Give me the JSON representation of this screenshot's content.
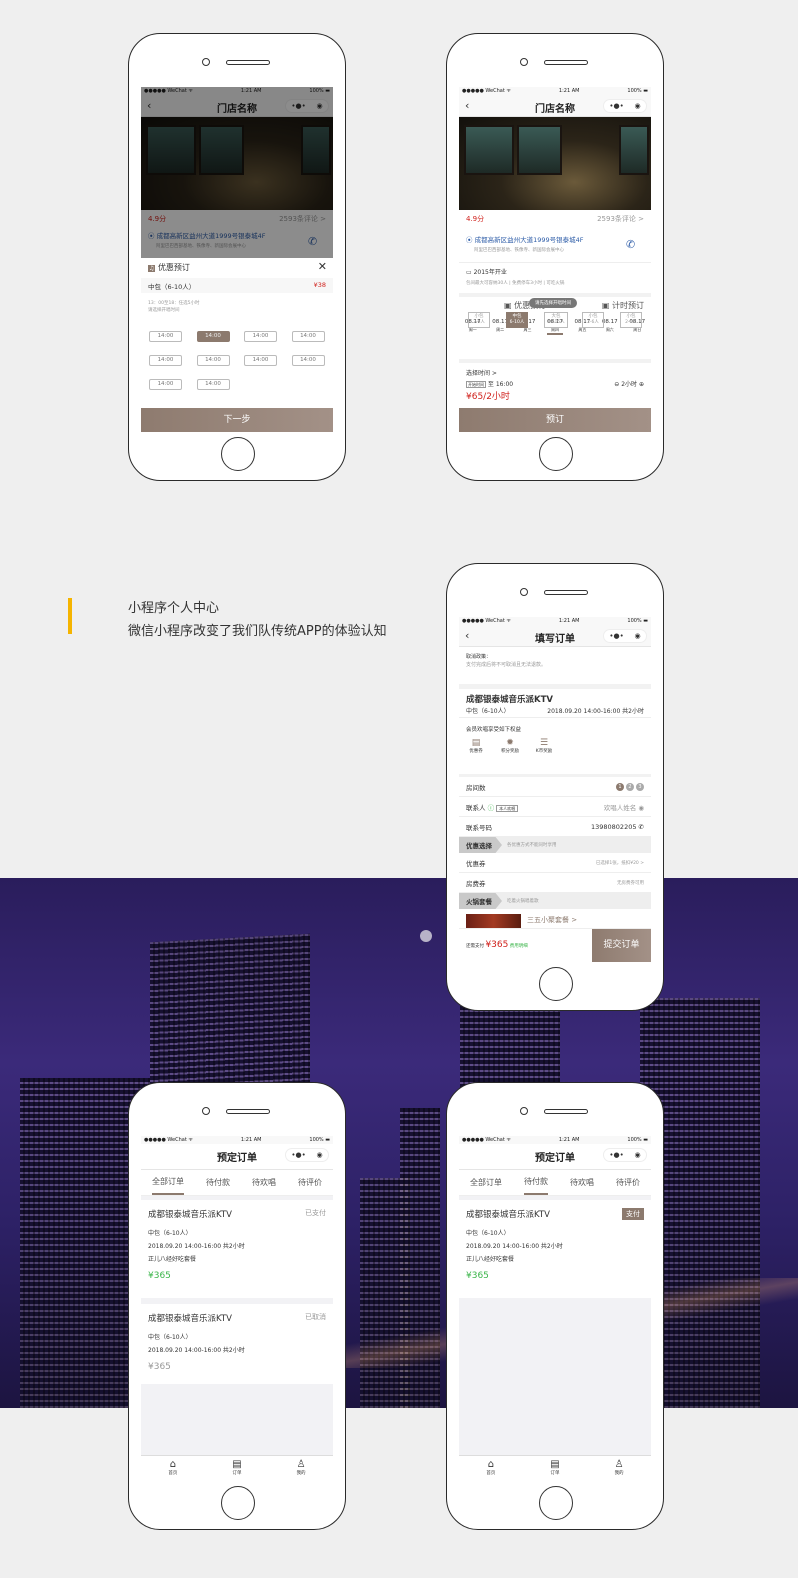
{
  "status": {
    "carrier": "●●●●● WeChat ᯤ",
    "time": "1:21 AM",
    "battery": "100% ▬"
  },
  "intro": {
    "title": "小程序个人中心",
    "subtitle": "微信小程序改变了我们队传统APP的体验认知",
    "accent": "#f5b400"
  },
  "store": {
    "title": "门店名称",
    "rating": "4.9分",
    "reviews": "2593条评论 >",
    "address": "成都高新区益州大道1999号银泰城4F",
    "address_sub": "阿里巴巴西部基地、铁像寺、新国际会展中心",
    "opened": "2015年开业",
    "facts": "包间最大可容纳30人 | 免费停车3小时 | 可吃火锅"
  },
  "popup": {
    "title": "优惠预订",
    "room": "中包（6-10人）",
    "price": "¥38",
    "hint1": "13：00至18：任选5小时",
    "hint2": "请选择开唱时间",
    "times": [
      "14:00",
      "14:00",
      "14:00",
      "14:00",
      "14:00",
      "14:00",
      "14:00",
      "14:00",
      "14:00",
      "14:00"
    ],
    "selected_index": 1,
    "next": "下一步"
  },
  "booking": {
    "tab1": "优惠预订",
    "tab2": "计时预订",
    "tooltip": "请先选择开唱时间",
    "dates": [
      {
        "d": "08.17",
        "w": "周一"
      },
      {
        "d": "08.17",
        "w": "周二"
      },
      {
        "d": "08.17",
        "w": "周三"
      },
      {
        "d": "08.17",
        "w": "周四"
      },
      {
        "d": "08.17",
        "w": "周五"
      },
      {
        "d": "08.17",
        "w": "周六"
      },
      {
        "d": "08.17",
        "w": "周日"
      }
    ],
    "rooms": [
      {
        "n": "小包",
        "c": "2-6人"
      },
      {
        "n": "中包",
        "c": "6-10人"
      },
      {
        "n": "大包",
        "c": "10-15人"
      },
      {
        "n": "小包",
        "c": "2-6人"
      },
      {
        "n": "小包",
        "c": "2-6人"
      }
    ],
    "select_time": "选择时间 >",
    "start_tag": "开始时间",
    "to": "至 16:00",
    "duration": "2小时",
    "price": "¥65/2小时",
    "book": "预订"
  },
  "order": {
    "title": "填写订单",
    "policy_title": "取消政策：",
    "policy": "支付完成后将不可取消且无法退款。",
    "ktv": "成都银泰城音乐派KTV",
    "room": "中包（6-10人）",
    "when": "2018.09.20  14:00-16:00  共2小时",
    "member": "会员欢唱享受如下权益",
    "benefits": [
      "优惠券",
      "积分奖励",
      "K币奖励"
    ],
    "rooms_label": "房间数",
    "rooms_opts": [
      "1",
      "2",
      "3"
    ],
    "contact_label": "联系人",
    "contact_tag": "本人欢唱",
    "contact_ph": "欢唱人姓名",
    "phone_label": "联系号码",
    "phone": "13980802205",
    "discount_sec": "优惠选择",
    "discount_note": "各优惠方式不能同时享用",
    "coupon": "优惠券",
    "coupon_val": "已选择1张，抵扣¥20 >",
    "roomcoupon": "房费券",
    "roomcoupon_val": "无房费券可用",
    "hotpot_sec": "火锅套餐",
    "hotpot_note": "吃着火锅唱着歌",
    "package": "三五小聚套餐 >",
    "pay_label": "还需支付",
    "pay": "¥365",
    "detail": "费用明细",
    "submit": "提交订单"
  },
  "orders": {
    "title": "预定订单",
    "tabs": [
      "全部订单",
      "待付款",
      "待欢唱",
      "待评价"
    ],
    "list_all": [
      {
        "name": "成都银泰城音乐派KTV",
        "status": "已支付",
        "room": "中包（6-10人）",
        "when": "2018.09.20    14:00-16:00    共2小时",
        "pkg": "正儿八经好吃套餐",
        "price": "¥365"
      },
      {
        "name": "成都银泰城音乐派KTV",
        "status": "已取消",
        "room": "中包（6-10人）",
        "when": "2018.09.20    14:00-16:00    共2小时",
        "price": "¥365"
      }
    ],
    "list_pay": [
      {
        "name": "成都银泰城音乐派KTV",
        "status": "支付",
        "room": "中包（6-10人）",
        "when": "2018.09.20    14:00-16:00    共2小时",
        "pkg": "正儿八经好吃套餐",
        "price": "¥365"
      }
    ],
    "tabbar": [
      "首页",
      "订单",
      "我的"
    ]
  },
  "colors": {
    "brand": "#8c7a6e",
    "price_red": "#d0211c",
    "price_green": "#3bb54a"
  }
}
